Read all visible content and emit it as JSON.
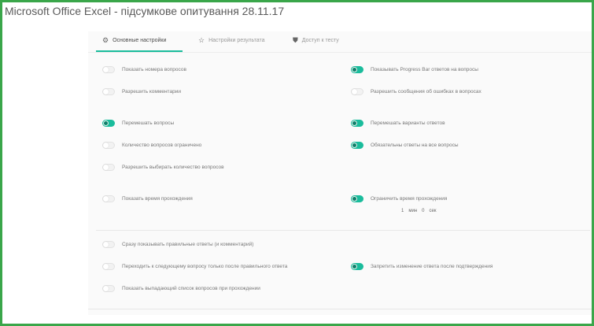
{
  "window": {
    "title": "Microsoft Office Excel - підсумкове опитування 28.11.17"
  },
  "tabs": [
    {
      "label": "Основные настройки",
      "icon": "gear-icon",
      "active": true
    },
    {
      "label": "Настройки результата",
      "icon": "star-icon",
      "active": false
    },
    {
      "label": "Доступ к тесту",
      "icon": "shield-icon",
      "active": false
    }
  ],
  "options": [
    {
      "label": "Показать номера вопросов",
      "on": false
    },
    {
      "label": "Показывать Progress Bar ответов на вопросы",
      "on": true
    },
    {
      "label": "Разрешить комментарии",
      "on": false
    },
    {
      "label": "Разрешить сообщения об ошибках в вопросах",
      "on": false
    },
    {
      "label": "Перемешать вопросы",
      "on": true
    },
    {
      "label": "Перемешать варианты ответов",
      "on": true
    },
    {
      "label": "Количество вопросов ограничено",
      "on": false
    },
    {
      "label": "Обязательны ответы на все вопросы",
      "on": true
    },
    {
      "label": "Разрешить выбирать количество вопросов",
      "on": false
    },
    {
      "label": "Показать время прохождения",
      "on": false
    },
    {
      "label": "Ограничить время прохождения",
      "on": true
    },
    {
      "label": "Сразу показывать правильные ответы (и комментарий)",
      "on": false
    },
    {
      "label": "Переходить к следующему вопросу только после правильного ответа",
      "on": false
    },
    {
      "label": "Запретить изменение ответа после подтверждения",
      "on": true
    },
    {
      "label": "Показать выпадающий список вопросов при прохождении",
      "on": false
    }
  ],
  "time_limit": {
    "hours_value": "1",
    "hours_unit": "мин",
    "seconds_value": "0",
    "seconds_unit": "сек"
  },
  "colors": {
    "frame": "#3aa64a",
    "accent": "#1abc9c"
  }
}
